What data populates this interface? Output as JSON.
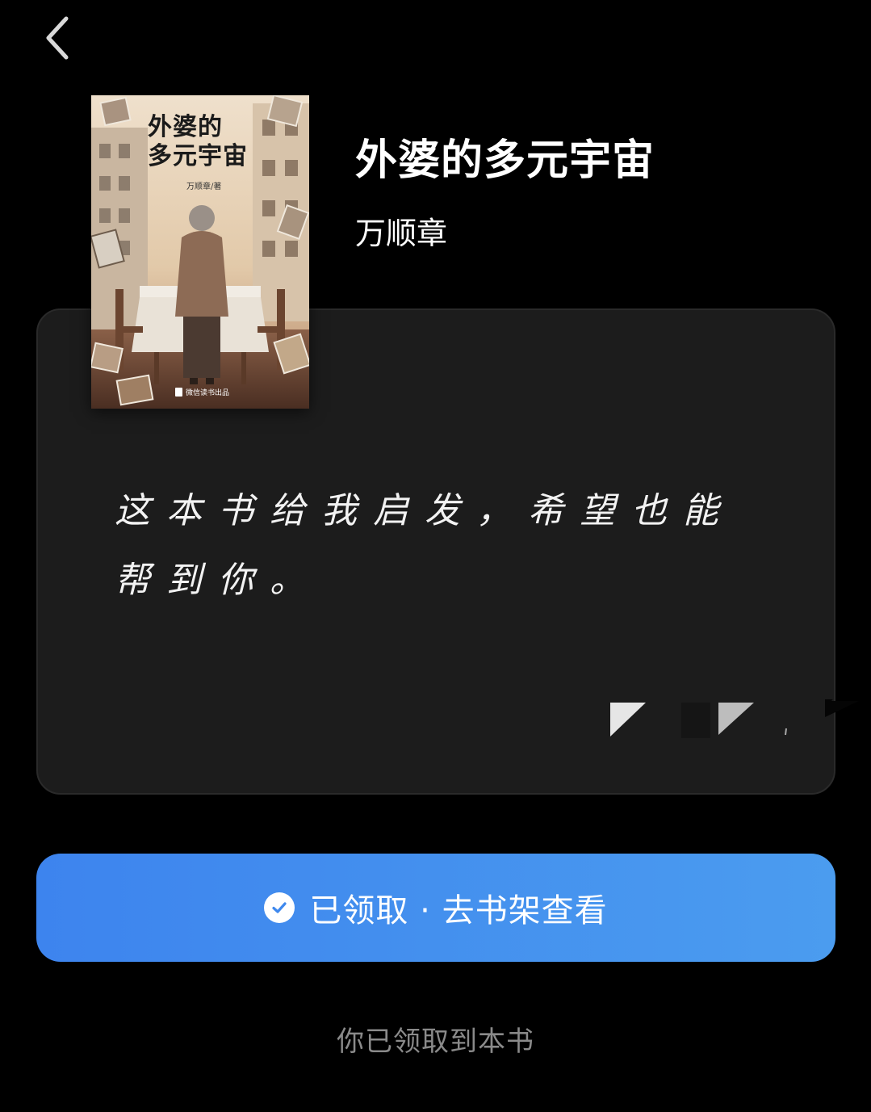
{
  "nav": {
    "back_icon": "chevron-left-icon"
  },
  "book": {
    "title": "外婆的多元宇宙",
    "author": "万顺章",
    "cover": {
      "title_line1": "外婆的",
      "title_line2": "多元宇宙",
      "author_credit": "万顺章/著",
      "publisher": "微信读书出品"
    }
  },
  "gift_card": {
    "message": "这本书给我启发，希望也能帮到你。",
    "background_color": "#1c1c1c"
  },
  "claim_button": {
    "icon": "check-circle-icon",
    "label": "已领取 · 去书架查看",
    "color_start": "#3d84ee",
    "color_end": "#4b9cef"
  },
  "footer": {
    "note": "你已领取到本书"
  }
}
